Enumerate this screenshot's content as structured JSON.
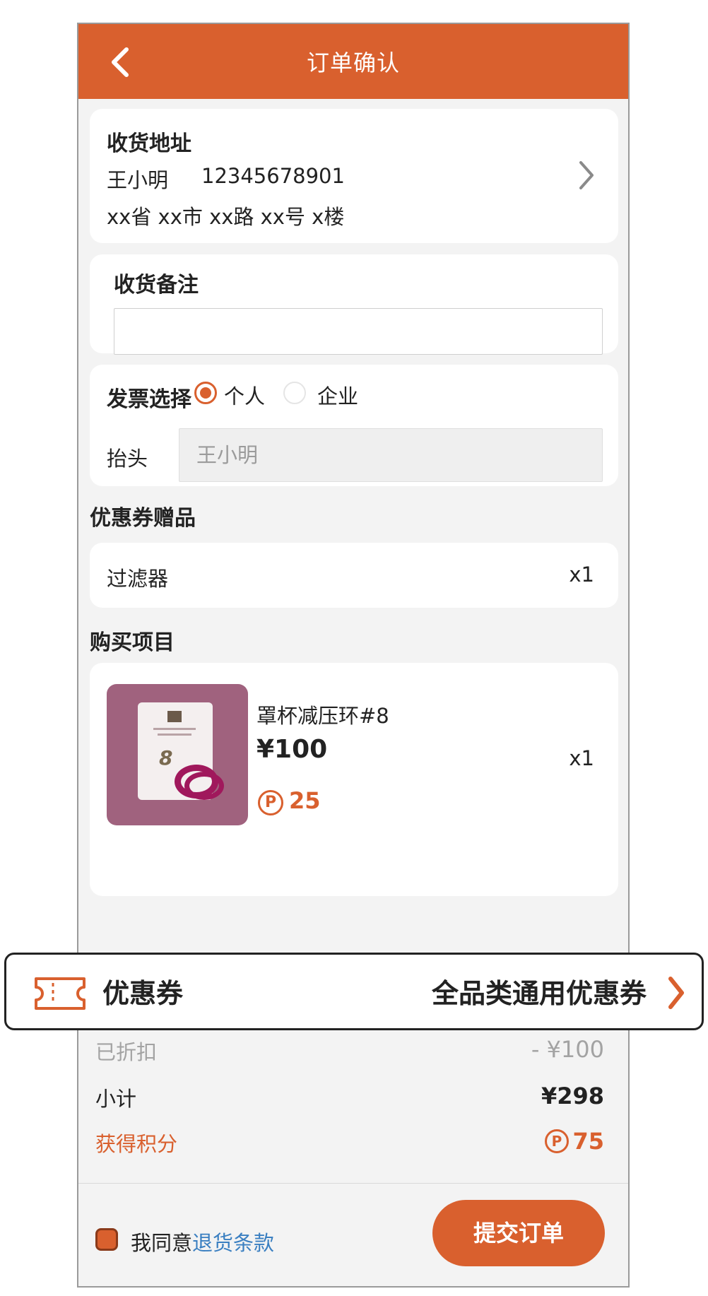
{
  "header": {
    "title": "订单确认"
  },
  "address": {
    "label": "收货地址",
    "name": "王小明",
    "phone": "12345678901",
    "detail": "xx省 xx市 xx路 xx号 x楼"
  },
  "note": {
    "label": "收货备注",
    "value": "",
    "placeholder": ""
  },
  "invoice": {
    "label": "发票选择",
    "options": [
      "个人",
      "企业"
    ],
    "selected": "个人",
    "title_label": "抬头",
    "title_placeholder": "王小明"
  },
  "gifts": {
    "section_title": "优惠券赠品",
    "items": [
      {
        "name": "过滤器",
        "qty": "x1"
      }
    ]
  },
  "purchase": {
    "section_title": "购买项目",
    "items": [
      {
        "name": "罩杯减压环#8",
        "price": "¥100",
        "points": "25",
        "qty": "x1"
      }
    ]
  },
  "coupon": {
    "label": "优惠券",
    "value": "全品类通用优惠券"
  },
  "summary": {
    "discount_label": "已折扣",
    "discount_value": "- ¥100",
    "subtotal_label": "小计",
    "subtotal_value": "¥298",
    "points_label": "获得积分",
    "points_value": "75"
  },
  "footer": {
    "agree_text": "我同意",
    "terms_link": "退货条款",
    "submit_label": "提交订单",
    "agreed": true
  },
  "colors": {
    "accent": "#d9602e",
    "link": "#3a7fc1",
    "background": "#f3f3f3"
  },
  "icons": {
    "back": "chevron-left-icon",
    "address_arrow": "chevron-right-icon",
    "coupon": "ticket-icon",
    "points": "points-p-icon"
  }
}
